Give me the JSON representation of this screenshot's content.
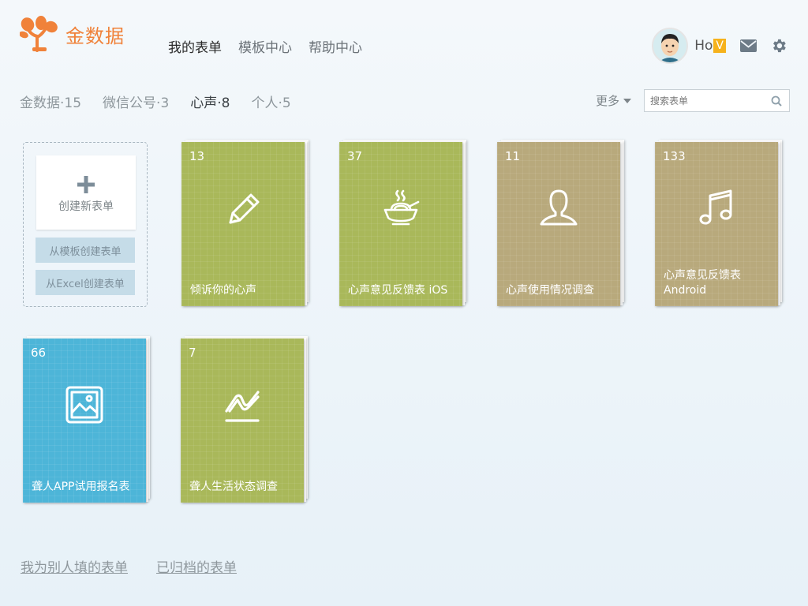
{
  "header": {
    "brand": "金数据",
    "nav": [
      {
        "label": "我的表单",
        "active": true
      },
      {
        "label": "模板中心",
        "active": false
      },
      {
        "label": "帮助中心",
        "active": false
      }
    ],
    "user": {
      "name": "Ho",
      "badge": "V"
    }
  },
  "filters": {
    "groups": [
      {
        "label": "金数据·15",
        "active": false
      },
      {
        "label": "微信公号·3",
        "active": false
      },
      {
        "label": "心声·8",
        "active": true
      },
      {
        "label": "个人·5",
        "active": false
      }
    ],
    "more_label": "更多",
    "search_placeholder": "搜索表单"
  },
  "create": {
    "new_label": "创建新表单",
    "from_template_label": "从模板创建表单",
    "from_excel_label": "从Excel创建表单"
  },
  "forms": [
    {
      "count": "13",
      "title": "倾诉你的心声",
      "icon": "pencil-icon",
      "color": "#a9b85a"
    },
    {
      "count": "37",
      "title": "心声意见反馈表 iOS",
      "icon": "noodle-bowl-icon",
      "color": "#a9b85a"
    },
    {
      "count": "11",
      "title": "心声使用情况调查",
      "icon": "person-icon",
      "color": "#b8a97c"
    },
    {
      "count": "133",
      "title": "心声意见反馈表 Android",
      "icon": "music-note-icon",
      "color": "#b8a97c"
    },
    {
      "count": "66",
      "title": "聋人APP试用报名表",
      "icon": "picture-icon",
      "color": "#4db5d8"
    },
    {
      "count": "7",
      "title": "聋人生活状态调查",
      "icon": "line-chart-icon",
      "color": "#a9b85a"
    }
  ],
  "footer": {
    "filled_label": "我为别人填的表单",
    "archived_label": "已归档的表单"
  }
}
